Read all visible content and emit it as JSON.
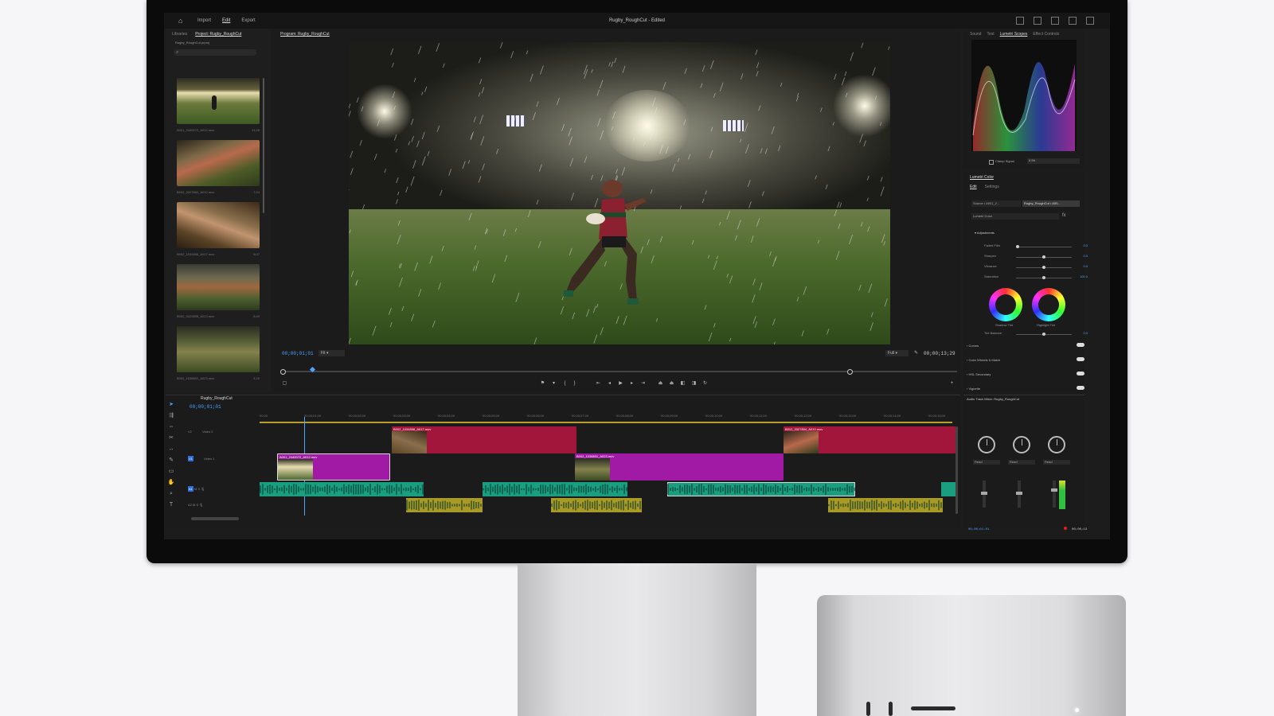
{
  "app": {
    "title": "Rugby_RoughCut - Edited",
    "menu": [
      "Import",
      "Edit",
      "Export"
    ],
    "active_menu": "Edit"
  },
  "project_panel": {
    "tabs": [
      "Libraries",
      "Project: Rugby_RoughCut"
    ],
    "project_file": "Rugby_RoughCut.prproj",
    "clips": [
      {
        "name": "A001_2440072_A012.mov",
        "duration": "11;29"
      },
      {
        "name": "B002_0327804_A010.mov",
        "duration": "7;04"
      },
      {
        "name": "B002_1034808_A017.mov",
        "duration": "5;07"
      },
      {
        "name": "B002_0429805_A013.mov",
        "duration": "8;49"
      },
      {
        "name": "B002_1038801_A023.mov",
        "duration": "4;29"
      }
    ]
  },
  "program": {
    "tab": "Program: Rugby_RoughCut",
    "current_tc": "00;00;01;01",
    "fit": "Fit",
    "quality": "Full",
    "duration_tc": "00;00;13;29"
  },
  "timeline": {
    "tab": "Rugby_RoughCut",
    "current_tc": "00;00;01;01",
    "ruler": [
      "00;00",
      "00;00;01;00",
      "00;00;02;00",
      "00;00;03;00",
      "00;00;04;00",
      "00;00;05;00",
      "00;00;06;00",
      "00;00;07;00",
      "00;00;08;00",
      "00;00;09;00",
      "00;00;10;00",
      "00;00;11;00",
      "00;00;12;00",
      "00;00;13;00",
      "00;00;14;00",
      "00;00;15;00"
    ],
    "tracks": {
      "v2": "V2",
      "v1": "V1",
      "a1": "A1",
      "a2": "A2"
    },
    "track_names": {
      "v2": "Video 2",
      "v1": "Video 1"
    },
    "clips": {
      "v2_a": "B002_1034808_A017.mov",
      "v2_b": "B012_0327804_A010.mov",
      "v1_a": "A001_2440072_A012.mov",
      "v1_b": "B002_1038801_A023.mov"
    }
  },
  "scopes": {
    "tabs": [
      "Sound",
      "Text",
      "Lumetri Scopes",
      "Effect Controls"
    ],
    "clamp_label": "Clamp Signal",
    "bit_depth": "8 Bit"
  },
  "lumetri": {
    "tab": "Lumetri Color",
    "subtabs": [
      "Edit",
      "Settings"
    ],
    "source": "Source • A001_2...",
    "sequence": "Rugby_RoughCut • A00...",
    "effect": "Lumetri Color",
    "adjustments_label": "Adjustments",
    "sliders": [
      {
        "label": "Faded Film",
        "value": "0.0",
        "pos": 0.0
      },
      {
        "label": "Sharpen",
        "value": "0.0",
        "pos": 0.5
      },
      {
        "label": "Vibrance",
        "value": "0.0",
        "pos": 0.5
      },
      {
        "label": "Saturation",
        "value": "100.0",
        "pos": 0.5
      }
    ],
    "wheels": [
      "Shadow Tint",
      "Highlight Tint"
    ],
    "tint_balance": {
      "label": "Tint Balance",
      "value": "0.0",
      "pos": 0.5
    },
    "sections": [
      "Curves",
      "Color Wheels & Match",
      "HSL Secondary",
      "Vignette"
    ]
  },
  "mixer": {
    "tab": "Audio Track Mixer: Rugby_RoughCut",
    "tc": "00;00;01;01",
    "end_tc": "00;00;13",
    "modes": [
      "Read",
      "Read",
      "Read"
    ]
  },
  "colors": {
    "accent": "#4da3ff",
    "v2_clip": "#a3163c",
    "v1_clip": "#a11aa6",
    "a1_clip": "#1a9e80",
    "a2_clip": "#a89a25"
  }
}
